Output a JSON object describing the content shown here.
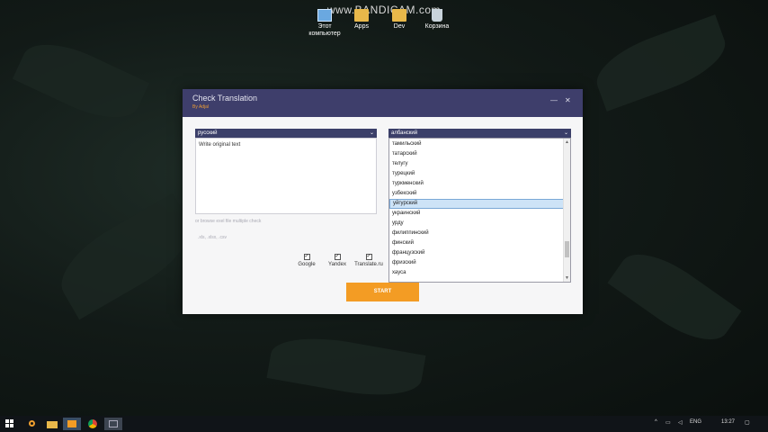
{
  "watermark": "www.BANDICAM.com",
  "desktop_icons": [
    {
      "label": "Этот компьютер",
      "icon": "computer-icon"
    },
    {
      "label": "Apps",
      "icon": "folder-icon"
    },
    {
      "label": "Dev",
      "icon": "folder-icon"
    },
    {
      "label": "Корзина",
      "icon": "recycle-bin-icon"
    }
  ],
  "window": {
    "title": "Check Translation",
    "subtitle": "By Adjal",
    "minimize": "—",
    "close": "✕"
  },
  "source": {
    "language": "русский",
    "placeholder": "Write original text",
    "browse_hint": "or browse exel file multiple check",
    "file_formats": ".xls, .xlsx, .csv"
  },
  "target": {
    "language": "албанский",
    "options": [
      "тамильский",
      "татарский",
      "телугу",
      "турецкий",
      "туркменский",
      "узбекский",
      "уйгурский",
      "украинский",
      "урду",
      "филиппинский",
      "финский",
      "французский",
      "фризский",
      "хауса"
    ],
    "selected": "уйгурский"
  },
  "services": [
    {
      "label": "Google",
      "checked": true
    },
    {
      "label": "Yandex",
      "checked": true
    },
    {
      "label": "Translate.ru",
      "checked": true
    }
  ],
  "start_label": "START",
  "taskbar": {
    "language": "ENG",
    "time": "13:27"
  },
  "colors": {
    "titlebar": "#3e3e6b",
    "accent": "#f39c24",
    "select_bg": "#3b3f69",
    "selected_option": "#cde3f7"
  }
}
